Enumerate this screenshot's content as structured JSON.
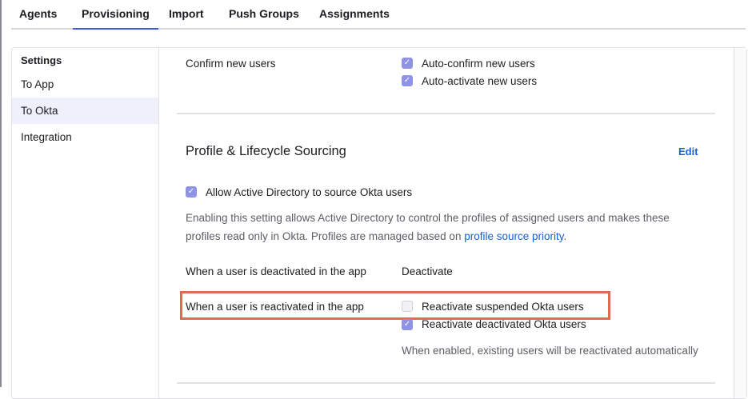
{
  "tabs": [
    "Agents",
    "Provisioning",
    "Import",
    "Push Groups",
    "Assignments"
  ],
  "nav": {
    "heading": "Settings",
    "items": [
      "To App",
      "To Okta",
      "Integration"
    ]
  },
  "confirm": {
    "label": "Confirm new users",
    "options": [
      {
        "label": "Auto-confirm new users",
        "checked": true
      },
      {
        "label": "Auto-activate new users",
        "checked": true
      }
    ]
  },
  "sourcing": {
    "title": "Profile & Lifecycle Sourcing",
    "edit": "Edit",
    "allow": {
      "label": "Allow Active Directory to source Okta users",
      "checked": true
    },
    "desc1": "Enabling this setting allows Active Directory to control the profiles of assigned users and makes these",
    "desc2": "profiles read only in Okta. Profiles are managed based on ",
    "desc_link": "profile source priority",
    "desc_end": ".",
    "deactivated_label": "When a user is deactivated in the app",
    "deactivated_value": "Deactivate",
    "reactivated_label": "When a user is reactivated in the app",
    "reactivate_options": [
      {
        "label": "Reactivate suspended Okta users",
        "checked": false
      },
      {
        "label": "Reactivate deactivated Okta users",
        "checked": true
      }
    ],
    "note": "When enabled, existing users will be reactivated automatically"
  },
  "colors": {
    "accent": "#3f59e4",
    "checkbox": "#8f93e6",
    "highlight": "#e06b4f",
    "link": "#1662dd"
  }
}
